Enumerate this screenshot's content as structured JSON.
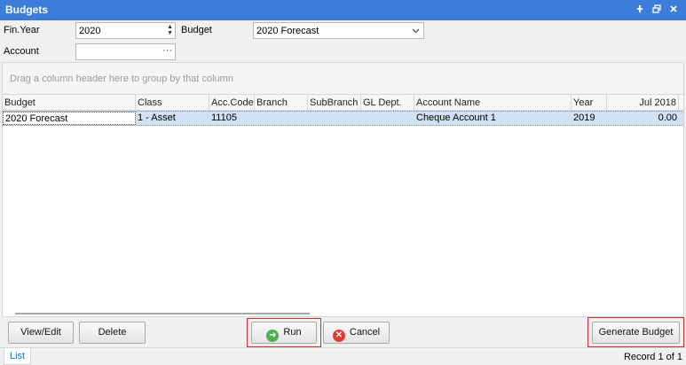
{
  "window": {
    "title": "Budgets",
    "controls": [
      "pin-icon",
      "restore-icon",
      "close-icon"
    ]
  },
  "filters": {
    "fin_year_label": "Fin.Year",
    "fin_year_value": "2020",
    "budget_label": "Budget",
    "budget_value": "2020 Forecast",
    "account_label": "Account",
    "account_value": "",
    "ellipsis": "···"
  },
  "grid": {
    "group_hint": "Drag a column header here to group by that column",
    "columns": [
      "Budget",
      "Class",
      "Acc.Code",
      "Branch",
      "SubBranch",
      "GL Dept.",
      "Account Name",
      "Year",
      "Jul 2018"
    ],
    "rows": [
      [
        "2020 Forecast",
        "1 - Asset",
        "11105",
        "",
        "",
        "",
        "Cheque Account 1",
        "2019",
        "0.00"
      ]
    ]
  },
  "toolbar": {
    "view_edit": "View/Edit",
    "delete": "Delete",
    "run": "Run",
    "cancel": "Cancel",
    "generate_budget": "Generate Budget"
  },
  "status": {
    "tab": "List",
    "record": "Record 1 of 1"
  },
  "colors": {
    "title_bar": "#3b7dd8",
    "selected_row": "#cfe1f3",
    "highlight_border": "#d0312d",
    "link": "#1f6fc5"
  }
}
